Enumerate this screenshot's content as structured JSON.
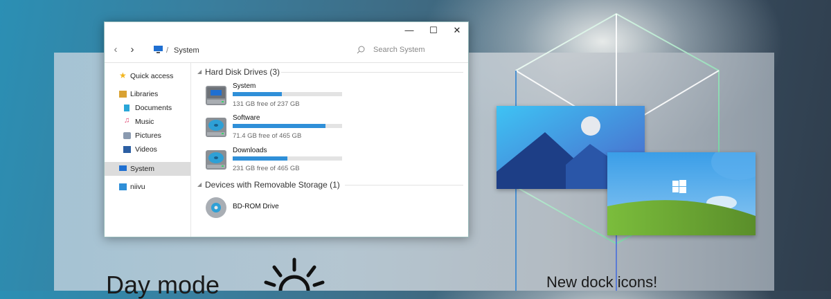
{
  "window": {
    "controls": {
      "minimize": "—",
      "maximize": "☐",
      "close": "✕"
    },
    "breadcrumb": {
      "separator": "/",
      "location": "System"
    },
    "search": {
      "placeholder": "Search System"
    }
  },
  "sidebar": {
    "items": [
      {
        "label": "Quick access",
        "icon": "star-icon"
      },
      {
        "label": "Libraries",
        "icon": "libraries-icon"
      },
      {
        "label": "Documents",
        "icon": "documents-icon"
      },
      {
        "label": "Music",
        "icon": "music-icon"
      },
      {
        "label": "Pictures",
        "icon": "pictures-icon"
      },
      {
        "label": "Videos",
        "icon": "videos-icon"
      },
      {
        "label": "System",
        "icon": "computer-icon",
        "selected": true
      },
      {
        "label": "niivu",
        "icon": "user-icon"
      }
    ]
  },
  "main": {
    "hard_disk_group": "Hard Disk Drives (3)",
    "drives": [
      {
        "name": "System",
        "free": "131 GB free of 237 GB",
        "used_fraction": 0.45,
        "icon": "system-drive-icon"
      },
      {
        "name": "Software",
        "free": "71.4 GB free of 465 GB",
        "used_fraction": 0.85,
        "icon": "hard-drive-icon"
      },
      {
        "name": "Downloads",
        "free": "231 GB free of 465 GB",
        "used_fraction": 0.5,
        "icon": "hard-drive-icon"
      }
    ],
    "removable_group": "Devices with Removable Storage (1)",
    "removable": [
      {
        "name": "BD-ROM Drive",
        "icon": "disc-icon"
      }
    ]
  },
  "promo": {
    "day_mode": "Day mode",
    "dock_icons": "New dock icons!"
  },
  "colors": {
    "accent": "#2f8fd8",
    "selection": "#dcdcdc"
  }
}
